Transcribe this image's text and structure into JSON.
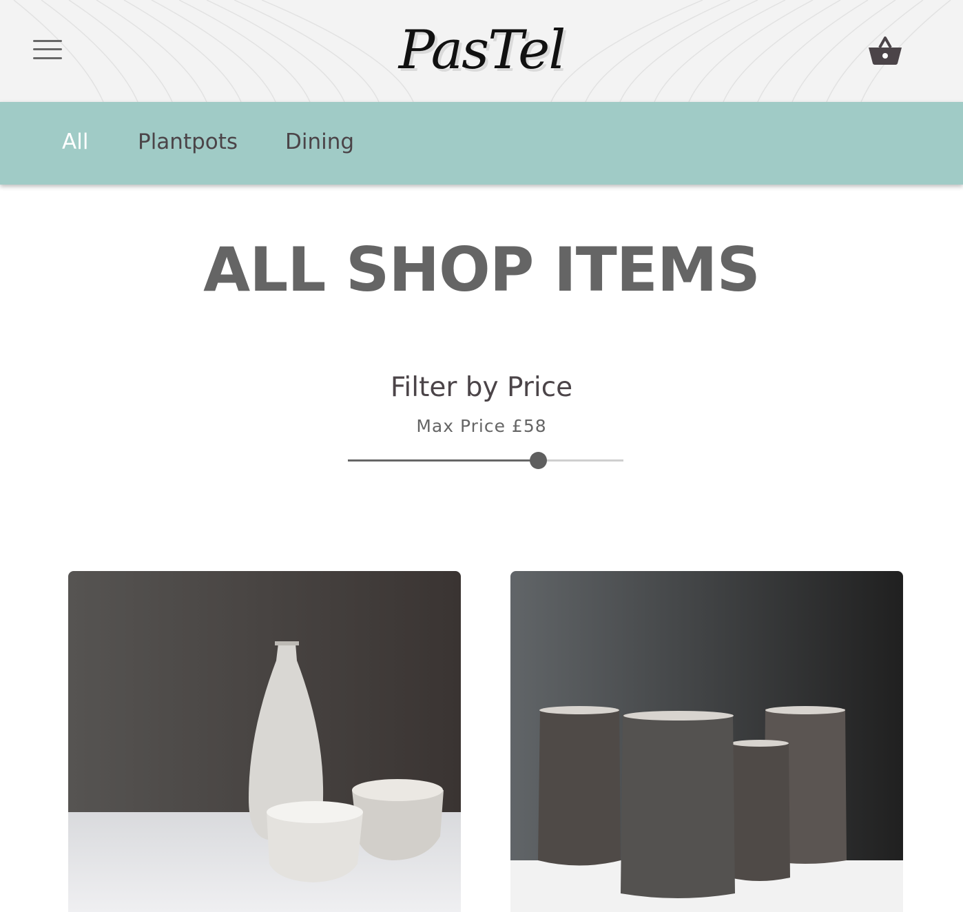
{
  "header": {
    "logo": "PasTel",
    "menu_icon": "hamburger-menu-icon",
    "basket_icon": "basket-icon"
  },
  "nav": {
    "items": [
      {
        "label": "All",
        "active": true
      },
      {
        "label": "Plantpots",
        "active": false
      },
      {
        "label": "Dining",
        "active": false
      }
    ]
  },
  "main": {
    "title": "ALL SHOP ITEMS",
    "filter": {
      "heading": "Filter by Price",
      "max_price_label": "Max Price £58",
      "slider_fraction": 0.69
    }
  },
  "products": [
    {
      "image": "white speckled ceramic bottle and cups"
    },
    {
      "image": "dark clay ceramic jugs"
    }
  ],
  "colors": {
    "header_bg": "#f3f3f3",
    "nav_bg": "#a0cbc6",
    "nav_active": "#ffffff",
    "nav_text": "#4b4448",
    "title": "#656565"
  }
}
